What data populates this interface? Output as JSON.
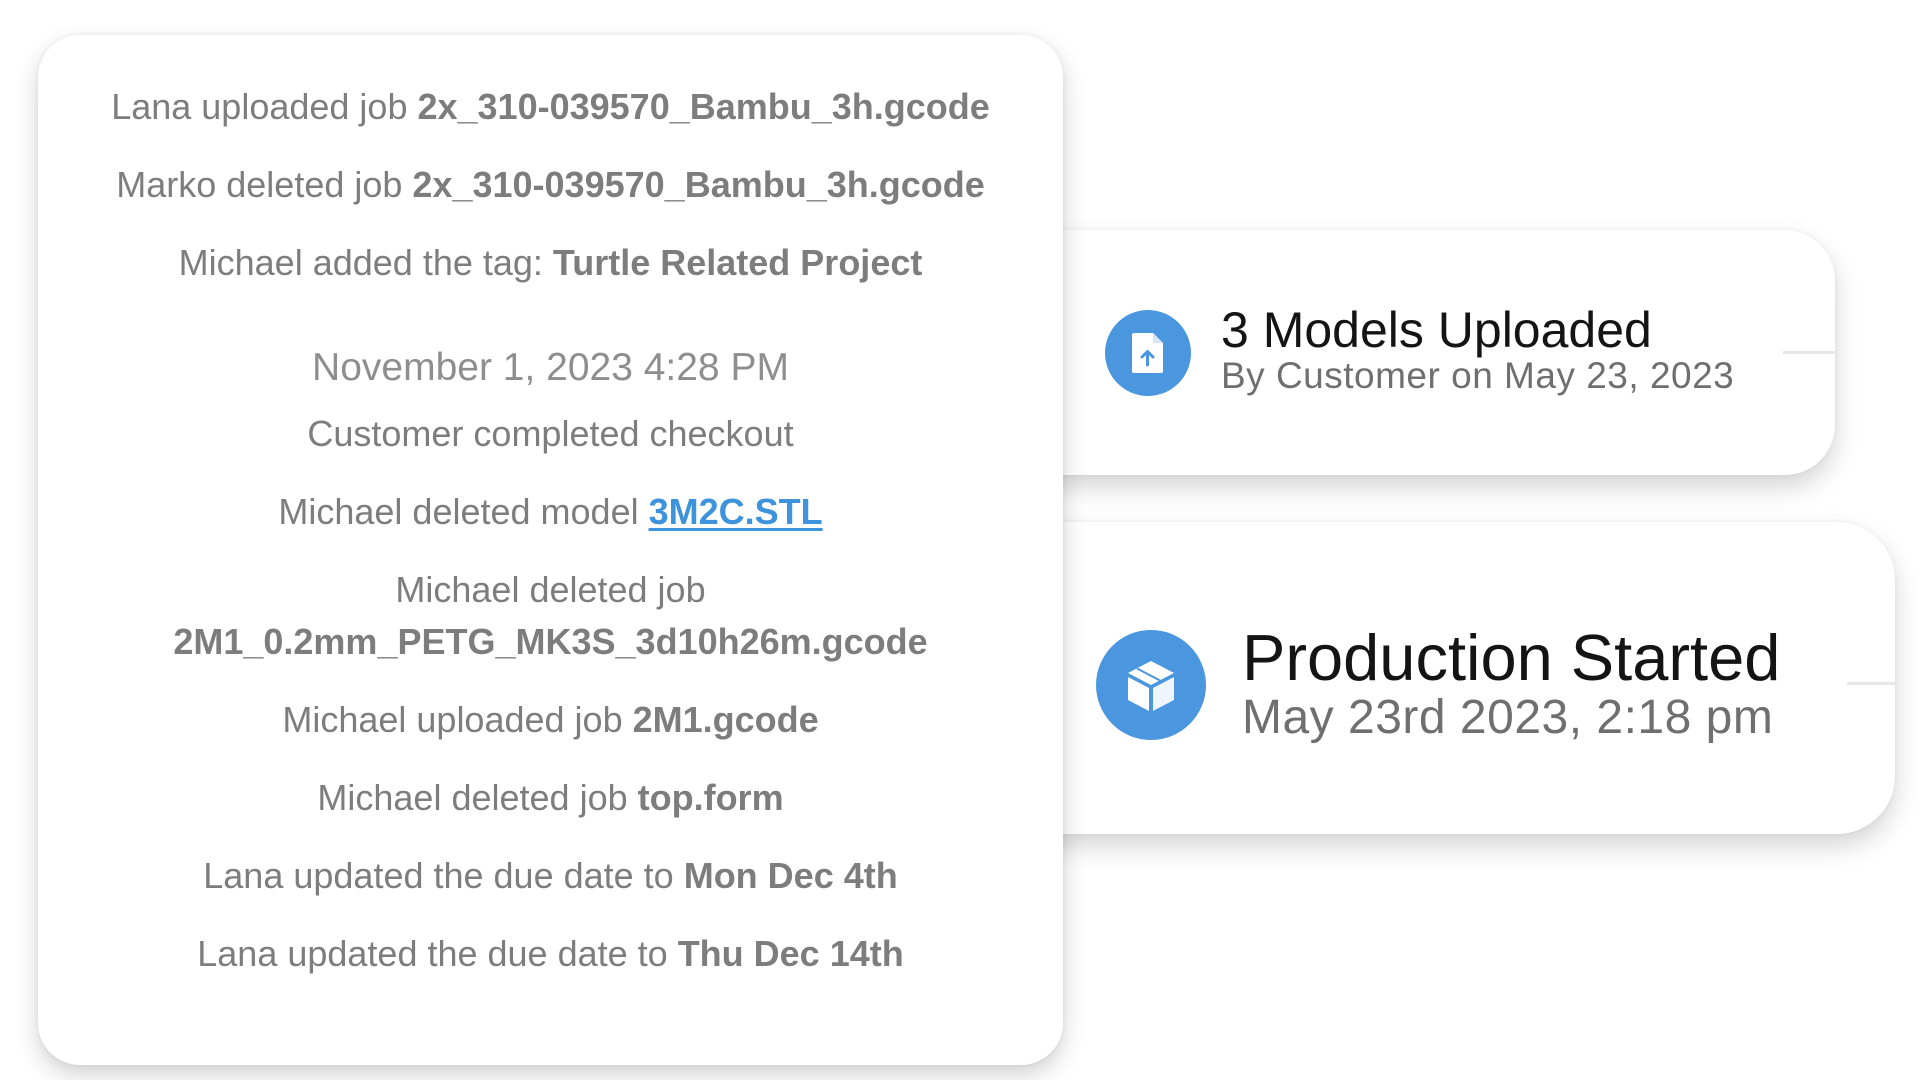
{
  "activity_log": {
    "entries": [
      {
        "text": "Lana uploaded job ",
        "bold": "2x_310-039570_Bambu_3h.gcode"
      },
      {
        "text": "Marko deleted job ",
        "bold": "2x_310-039570_Bambu_3h.gcode"
      },
      {
        "text": "Michael added the tag: ",
        "bold": "Turtle Related Project"
      }
    ],
    "date_header": "November 1, 2023 4:28 PM",
    "checkout_text": "Customer completed checkout",
    "deleted_model": {
      "text": "Michael deleted model ",
      "link": "3M2C.STL"
    },
    "deleted_job_long": {
      "text": "Michael deleted job",
      "bold": "2M1_0.2mm_PETG_MK3S_3d10h26m.gcode"
    },
    "entries_after": [
      {
        "text": "Michael uploaded job ",
        "bold": "2M1.gcode"
      },
      {
        "text": "Michael deleted job ",
        "bold": "top.form"
      },
      {
        "text": "Lana updated the due date to ",
        "bold": "Mon Dec 4th"
      },
      {
        "text": "Lana updated the due date to ",
        "bold": "Thu Dec 14th"
      }
    ]
  },
  "cards": {
    "upload": {
      "icon": "file-upload-icon",
      "title": "3 Models Uploaded",
      "subtitle": "By Customer on May 23, 2023"
    },
    "production": {
      "icon": "box-icon",
      "title": "Production Started",
      "subtitle": "May 23rd 2023, 2:18 pm"
    }
  },
  "colors": {
    "accent_blue": "#4a97e0",
    "link_blue": "#3d93dc",
    "log_text": "#7d7d7d",
    "card_title": "#141414",
    "card_subtitle": "#6f6f6f"
  }
}
